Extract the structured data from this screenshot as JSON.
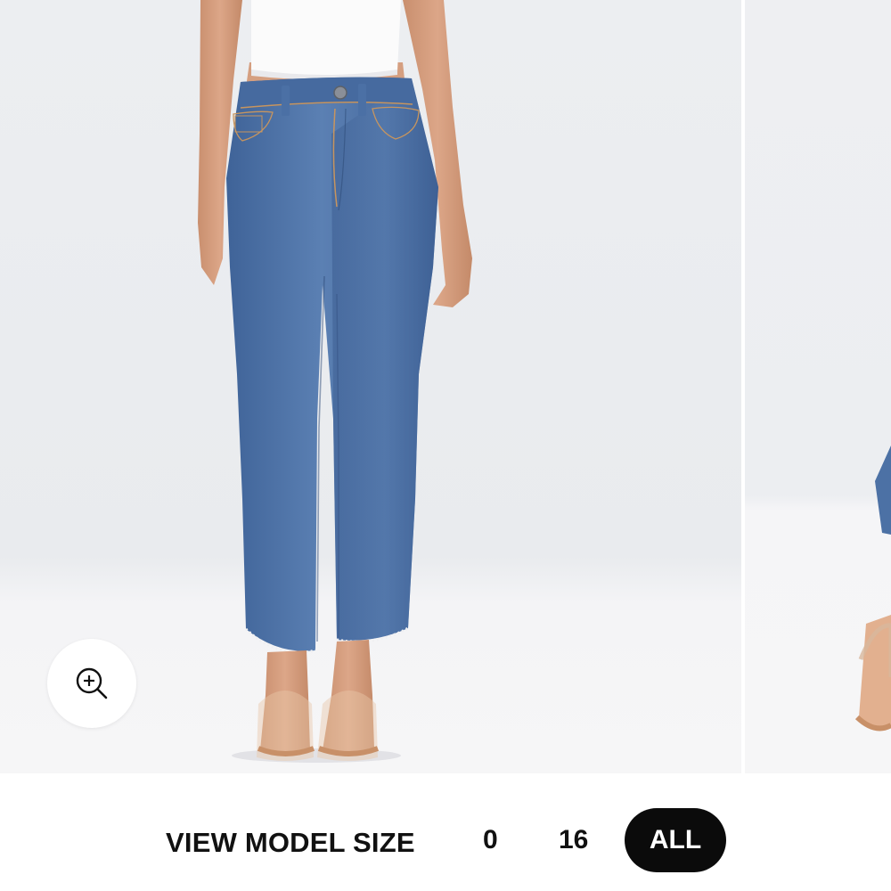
{
  "gallery": {
    "zoom_icon": "zoom-in-icon"
  },
  "model_size": {
    "label": "VIEW MODEL SIZE",
    "options": [
      "0",
      "16",
      "ALL"
    ],
    "selected": "ALL"
  },
  "colors": {
    "denim": "#4e73a6",
    "background": "#eceef1",
    "selected_pill": "#0b0b0b"
  }
}
